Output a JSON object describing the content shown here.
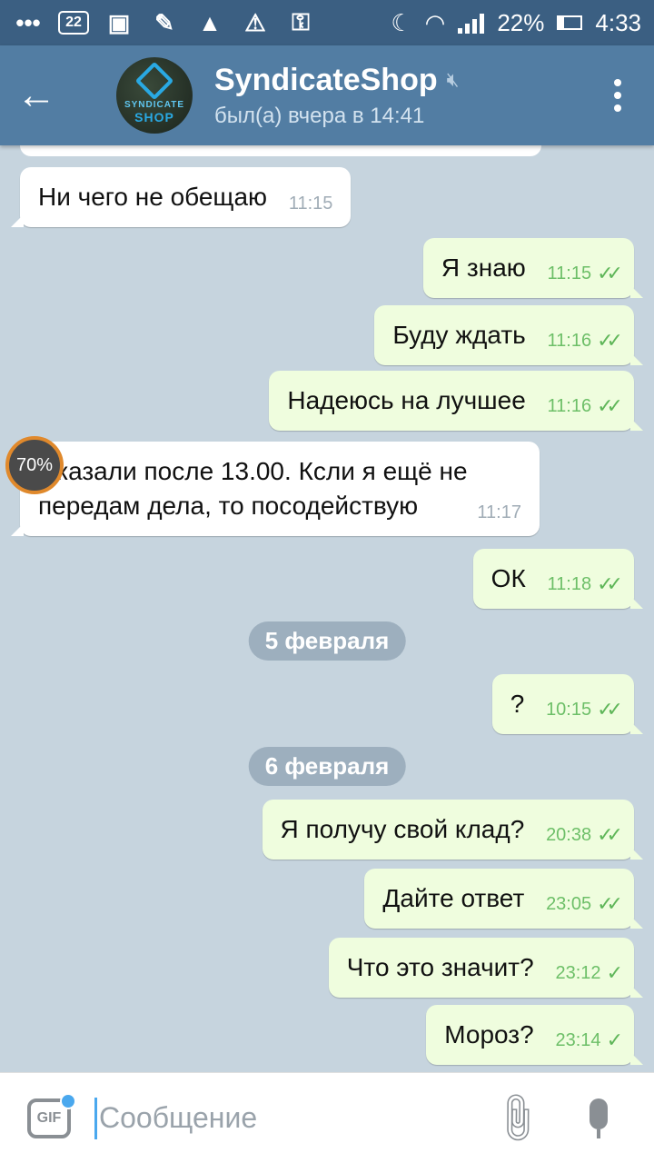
{
  "status_bar": {
    "notification_count": "22",
    "battery": "22%",
    "battery_level": 0.22,
    "time": "4:33",
    "icons": [
      "chat-icon",
      "sim-icon",
      "image-icon",
      "brush-icon",
      "photo-icon",
      "triangle-icon",
      "key-icon",
      "moon-icon",
      "wifi-icon",
      "signal-icon",
      "battery-icon"
    ]
  },
  "header": {
    "title": "SyndicateShop",
    "status": "был(а) вчера в 14:41",
    "avatar_text_top": "SYNDICATE",
    "avatar_text_bottom": "SHOP"
  },
  "progress_badge": "70%",
  "messages": [
    {
      "dir": "in",
      "text": "Ни чего не обещаю",
      "time": "11:15"
    },
    {
      "dir": "out",
      "text": "Я знаю",
      "time": "11:15",
      "status": "read"
    },
    {
      "dir": "out",
      "text": "Буду ждать",
      "time": "11:16",
      "status": "read"
    },
    {
      "dir": "out",
      "text": "Надеюсь на лучшее",
      "time": "11:16",
      "status": "read"
    },
    {
      "dir": "in",
      "text_line1": "Сказали после 13.00. Кcли я ещё не",
      "text_line2": "передам дела, то посодействую",
      "time": "11:17"
    },
    {
      "dir": "out",
      "text": "ОК",
      "time": "11:18",
      "status": "read"
    },
    {
      "type": "date",
      "text": "5 февраля"
    },
    {
      "dir": "out",
      "text": "?",
      "time": "10:15",
      "status": "read"
    },
    {
      "type": "date",
      "text": "6 февраля"
    },
    {
      "dir": "out",
      "text": "Я получу свой клад?",
      "time": "20:38",
      "status": "read"
    },
    {
      "dir": "out",
      "text": "Дайте ответ",
      "time": "23:05",
      "status": "read"
    },
    {
      "dir": "out",
      "text": "Что это значит?",
      "time": "23:12",
      "status": "sent"
    },
    {
      "dir": "out",
      "text": "Мороз?",
      "time": "23:14",
      "status": "sent"
    }
  ],
  "input": {
    "placeholder": "Сообщение",
    "gif_label": "GIF"
  },
  "check_read": "✓✓",
  "check_sent": "✓"
}
